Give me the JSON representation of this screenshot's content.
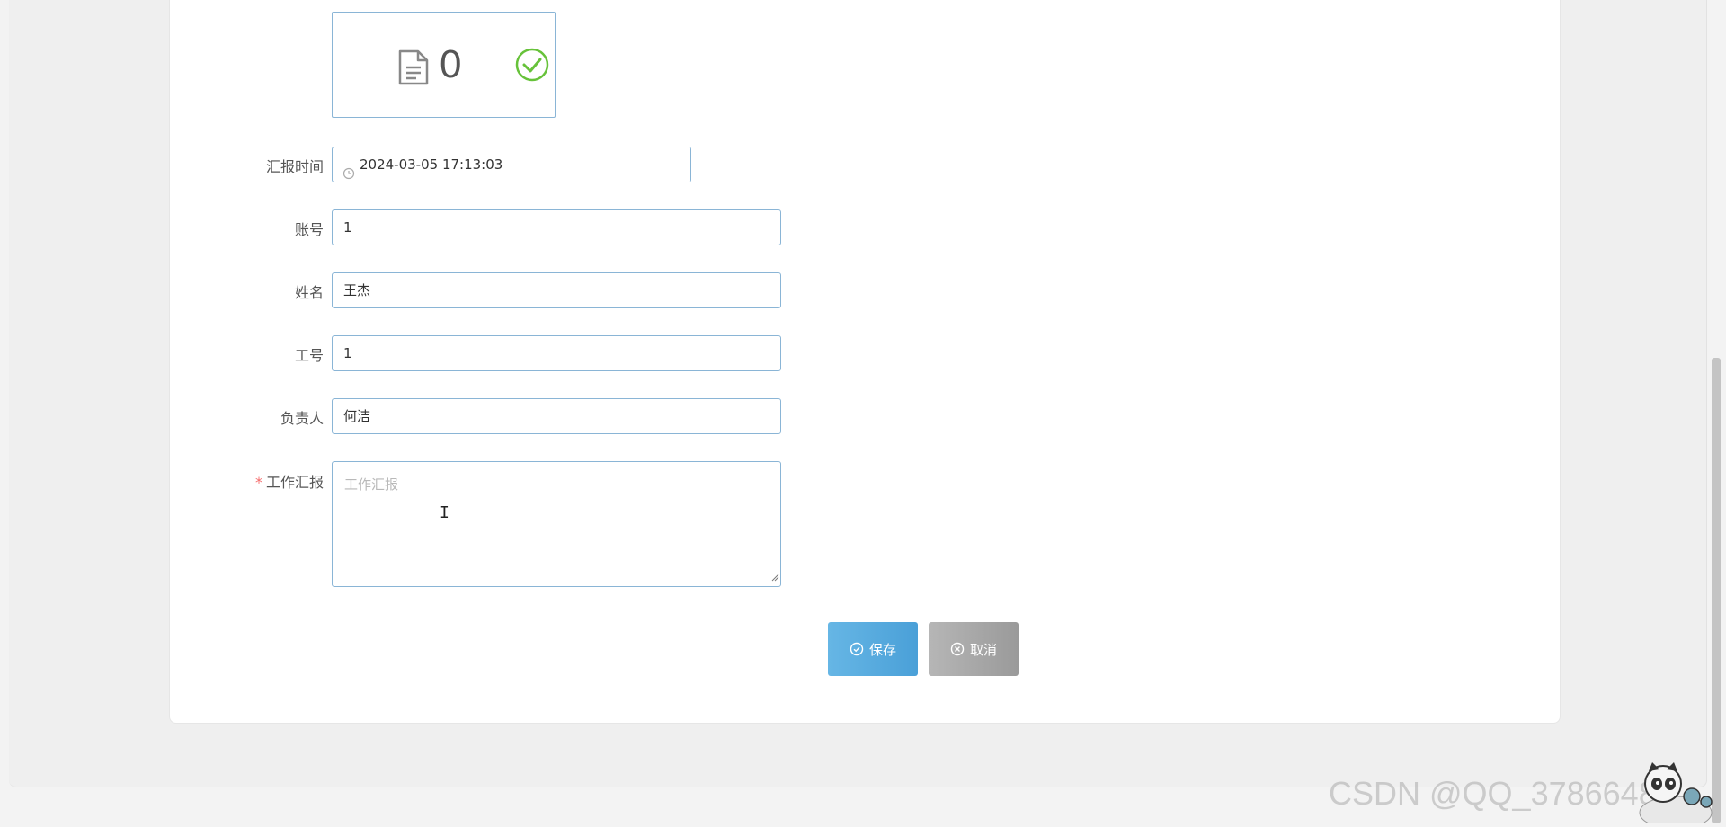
{
  "upload": {
    "count": "0",
    "file_icon": "file-icon",
    "status_icon": "check-circle-icon"
  },
  "form": {
    "report_time": {
      "label": "汇报时间",
      "value": "2024-03-05 17:13:03",
      "icon": "clock-icon"
    },
    "account": {
      "label": "账号",
      "value": "1"
    },
    "name": {
      "label": "姓名",
      "value": "王杰"
    },
    "employee_no": {
      "label": "工号",
      "value": "1"
    },
    "manager": {
      "label": "负责人",
      "value": "何洁"
    },
    "work_report": {
      "label": "工作汇报",
      "required_mark": "*",
      "placeholder": "工作汇报",
      "value": ""
    }
  },
  "buttons": {
    "save": "保存",
    "cancel": "取消"
  },
  "watermark": "CSDN @QQ_37866480",
  "colors": {
    "save": "#5aaee0",
    "cancel": "#a8a8a8",
    "border": "#8ab5d6",
    "required": "#f56c6c",
    "success": "#67c23a"
  }
}
